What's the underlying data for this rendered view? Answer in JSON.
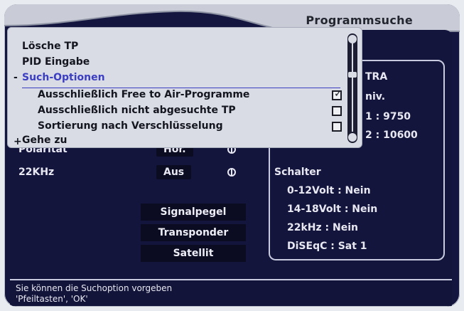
{
  "header": {
    "title": "Programmsuche"
  },
  "fields": {
    "polaritaet_label": "Polarität",
    "polaritaet_value": "Hor.",
    "khz_label": "22KHz",
    "khz_value": "Aus"
  },
  "buttons": {
    "signalpegel": "Signalpegel",
    "transponder": "Transponder",
    "satellit": "Satellit"
  },
  "satellite_info": {
    "name_fragment": "TRA",
    "lnb_fragment": "niv.",
    "lof1_fragment": "1 : 9750",
    "lof2_fragment": "2 : 10600",
    "schalter_label": "Schalter",
    "v12": "0-12Volt : Nein",
    "v18": "14-18Volt : Nein",
    "khz": "22kHz : Nein",
    "diseqc": "DiSEqC : Sat 1"
  },
  "menu": {
    "items": [
      {
        "label": "Lösche TP"
      },
      {
        "label": "PID Eingabe"
      },
      {
        "label": "Such-Optionen",
        "prefix": "-"
      },
      {
        "label": "Gehe zu",
        "prefix": "+"
      }
    ],
    "options": [
      {
        "label": "Ausschließlich Free to Air-Programme",
        "checked": true
      },
      {
        "label": "Ausschließlich nicht abgesuchte TP",
        "checked": false
      },
      {
        "label": "Sortierung nach Verschlüsselung",
        "checked": false
      }
    ]
  },
  "hint": {
    "line1": "Sie können die Suchoption vorgeben",
    "line2": "'Pfeiltasten', 'OK'"
  },
  "colors": {
    "screen_bg": "#15163f",
    "popup_bg": "#d9dce4",
    "selected_text": "#3c3ec2",
    "header_bg": "#c9ccd6"
  }
}
